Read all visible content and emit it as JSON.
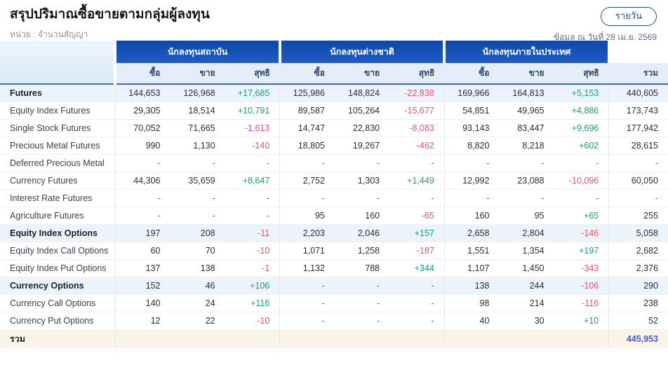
{
  "header": {
    "title": "สรุปปริมาณซื้อขายตามกลุ่มผู้ลงทุน",
    "unit_label": "หน่วย : จำนวนสัญญา",
    "period_button_label": "รายวัน",
    "as_of": "ข้อมูล ณ วันที่ 28 เม.ย. 2569"
  },
  "table": {
    "groups": [
      "นักลงทุนสถาบัน",
      "นักลงทุนต่างชาติ",
      "นักลงทุนภายในประเทศ"
    ],
    "sub_columns": [
      "ซื้อ",
      "ขาย",
      "สุทธิ"
    ],
    "total_column": "รวม",
    "rows": [
      {
        "label": "Futures",
        "section": true,
        "cells": [
          "144,653",
          "126,968",
          "+17,685",
          "125,986",
          "148,824",
          "-22,838",
          "169,966",
          "164,813",
          "+5,153",
          "440,605"
        ]
      },
      {
        "label": "Equity Index Futures",
        "section": false,
        "cells": [
          "29,305",
          "18,514",
          "+10,791",
          "89,587",
          "105,264",
          "-15,677",
          "54,851",
          "49,965",
          "+4,886",
          "173,743"
        ]
      },
      {
        "label": "Single Stock Futures",
        "section": false,
        "cells": [
          "70,052",
          "71,665",
          "-1,613",
          "14,747",
          "22,830",
          "-8,083",
          "93,143",
          "83,447",
          "+9,696",
          "177,942"
        ]
      },
      {
        "label": "Precious Metal Futures",
        "section": false,
        "cells": [
          "990",
          "1,130",
          "-140",
          "18,805",
          "19,267",
          "-462",
          "8,820",
          "8,218",
          "+602",
          "28,615"
        ]
      },
      {
        "label": "Deferred Precious Metal",
        "section": false,
        "cells": [
          "-",
          "-",
          "-",
          "-",
          "-",
          "-",
          "-",
          "-",
          "-",
          "-"
        ]
      },
      {
        "label": "Currency Futures",
        "section": false,
        "cells": [
          "44,306",
          "35,659",
          "+8,647",
          "2,752",
          "1,303",
          "+1,449",
          "12,992",
          "23,088",
          "-10,096",
          "60,050"
        ]
      },
      {
        "label": "Interest Rate Futures",
        "section": false,
        "cells": [
          "-",
          "-",
          "-",
          "-",
          "-",
          "-",
          "-",
          "-",
          "-",
          "-"
        ]
      },
      {
        "label": "Agriculture Futures",
        "section": false,
        "cells": [
          "-",
          "-",
          "-",
          "95",
          "160",
          "-65",
          "160",
          "95",
          "+65",
          "255"
        ]
      },
      {
        "label": "Equity Index Options",
        "section": true,
        "cells": [
          "197",
          "208",
          "-11",
          "2,203",
          "2,046",
          "+157",
          "2,658",
          "2,804",
          "-146",
          "5,058"
        ]
      },
      {
        "label": "Equity Index Call Options",
        "section": false,
        "cells": [
          "60",
          "70",
          "-10",
          "1,071",
          "1,258",
          "-187",
          "1,551",
          "1,354",
          "+197",
          "2,682"
        ]
      },
      {
        "label": "Equity Index Put Options",
        "section": false,
        "cells": [
          "137",
          "138",
          "-1",
          "1,132",
          "788",
          "+344",
          "1,107",
          "1,450",
          "-343",
          "2,376"
        ]
      },
      {
        "label": "Currency Options",
        "section": true,
        "cells": [
          "152",
          "46",
          "+106",
          "-",
          "-",
          "-",
          "138",
          "244",
          "-106",
          "290"
        ]
      },
      {
        "label": "Currency Call Options",
        "section": false,
        "cells": [
          "140",
          "24",
          "+116",
          "-",
          "-",
          "-",
          "98",
          "214",
          "-116",
          "238"
        ]
      },
      {
        "label": "Currency Put Options",
        "section": false,
        "cells": [
          "12",
          "22",
          "-10",
          "-",
          "-",
          "-",
          "40",
          "30",
          "+10",
          "52"
        ]
      }
    ],
    "total_row": {
      "label": "รวม",
      "cells": [
        "",
        "",
        "",
        "",
        "",
        "",
        "",
        "",
        ""
      ],
      "grand_total": "445,953"
    }
  },
  "colors": {
    "header_blue_top": "#0e47aa",
    "header_blue_bottom": "#1e5cc6",
    "subheader_bg": "#e4edf8",
    "section_row_bg": "#edf3fb",
    "total_row_bg": "#fdf4e8",
    "positive_green": "#12a375",
    "negative_red": "#e4556d",
    "grand_total_blue": "#3c5ed2",
    "button_blue": "#1d4f9e"
  }
}
